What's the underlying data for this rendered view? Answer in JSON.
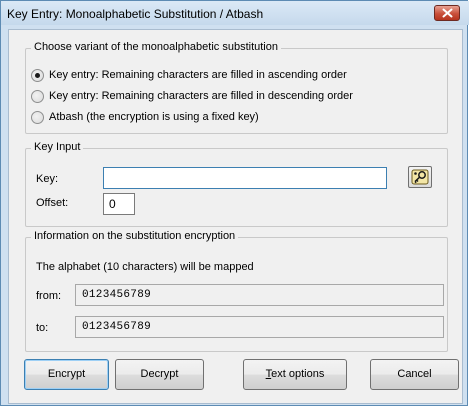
{
  "window": {
    "title": "Key Entry: Monoalphabetic Substitution / Atbash",
    "close_icon": "close-icon",
    "titlebar_color": "#c9dcef",
    "close_color": "#c9503b"
  },
  "variant_group": {
    "label": "Choose variant of the monoalphabetic substitution",
    "options": [
      {
        "label": "Key entry: Remaining characters are filled in ascending order",
        "checked": true
      },
      {
        "label": "Key entry: Remaining characters are filled in descending order",
        "checked": false
      },
      {
        "label": "Atbash (the encryption is using a fixed key)",
        "checked": false
      }
    ]
  },
  "key_group": {
    "label": "Key Input",
    "key_label": "Key:",
    "key_value": "",
    "offset_label": "Offset:",
    "offset_value": "0",
    "tool_icon": "key-wizard-icon"
  },
  "info_group": {
    "label": "Information on the substitution encryption",
    "description": "The alphabet (10 characters) will be mapped",
    "from_label": "from:",
    "from_value": "0123456789",
    "to_label": "to:",
    "to_value": "0123456789"
  },
  "buttons": {
    "encrypt": "Encrypt",
    "decrypt": "Decrypt",
    "text_options_accel": "T",
    "text_options_rest": "ext options",
    "cancel": "Cancel"
  }
}
